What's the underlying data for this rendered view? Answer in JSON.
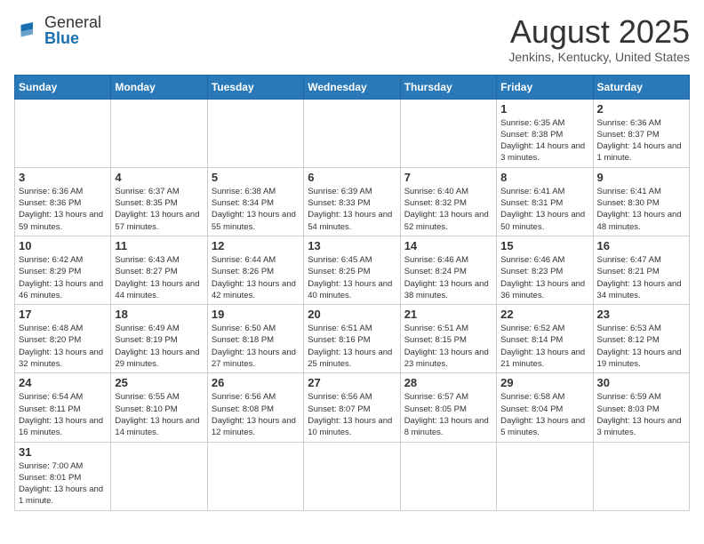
{
  "header": {
    "logo_general": "General",
    "logo_blue": "Blue",
    "month_title": "August 2025",
    "location": "Jenkins, Kentucky, United States"
  },
  "days_of_week": [
    "Sunday",
    "Monday",
    "Tuesday",
    "Wednesday",
    "Thursday",
    "Friday",
    "Saturday"
  ],
  "weeks": [
    [
      {
        "day": "",
        "info": ""
      },
      {
        "day": "",
        "info": ""
      },
      {
        "day": "",
        "info": ""
      },
      {
        "day": "",
        "info": ""
      },
      {
        "day": "",
        "info": ""
      },
      {
        "day": "1",
        "info": "Sunrise: 6:35 AM\nSunset: 8:38 PM\nDaylight: 14 hours and 3 minutes."
      },
      {
        "day": "2",
        "info": "Sunrise: 6:36 AM\nSunset: 8:37 PM\nDaylight: 14 hours and 1 minute."
      }
    ],
    [
      {
        "day": "3",
        "info": "Sunrise: 6:36 AM\nSunset: 8:36 PM\nDaylight: 13 hours and 59 minutes."
      },
      {
        "day": "4",
        "info": "Sunrise: 6:37 AM\nSunset: 8:35 PM\nDaylight: 13 hours and 57 minutes."
      },
      {
        "day": "5",
        "info": "Sunrise: 6:38 AM\nSunset: 8:34 PM\nDaylight: 13 hours and 55 minutes."
      },
      {
        "day": "6",
        "info": "Sunrise: 6:39 AM\nSunset: 8:33 PM\nDaylight: 13 hours and 54 minutes."
      },
      {
        "day": "7",
        "info": "Sunrise: 6:40 AM\nSunset: 8:32 PM\nDaylight: 13 hours and 52 minutes."
      },
      {
        "day": "8",
        "info": "Sunrise: 6:41 AM\nSunset: 8:31 PM\nDaylight: 13 hours and 50 minutes."
      },
      {
        "day": "9",
        "info": "Sunrise: 6:41 AM\nSunset: 8:30 PM\nDaylight: 13 hours and 48 minutes."
      }
    ],
    [
      {
        "day": "10",
        "info": "Sunrise: 6:42 AM\nSunset: 8:29 PM\nDaylight: 13 hours and 46 minutes."
      },
      {
        "day": "11",
        "info": "Sunrise: 6:43 AM\nSunset: 8:27 PM\nDaylight: 13 hours and 44 minutes."
      },
      {
        "day": "12",
        "info": "Sunrise: 6:44 AM\nSunset: 8:26 PM\nDaylight: 13 hours and 42 minutes."
      },
      {
        "day": "13",
        "info": "Sunrise: 6:45 AM\nSunset: 8:25 PM\nDaylight: 13 hours and 40 minutes."
      },
      {
        "day": "14",
        "info": "Sunrise: 6:46 AM\nSunset: 8:24 PM\nDaylight: 13 hours and 38 minutes."
      },
      {
        "day": "15",
        "info": "Sunrise: 6:46 AM\nSunset: 8:23 PM\nDaylight: 13 hours and 36 minutes."
      },
      {
        "day": "16",
        "info": "Sunrise: 6:47 AM\nSunset: 8:21 PM\nDaylight: 13 hours and 34 minutes."
      }
    ],
    [
      {
        "day": "17",
        "info": "Sunrise: 6:48 AM\nSunset: 8:20 PM\nDaylight: 13 hours and 32 minutes."
      },
      {
        "day": "18",
        "info": "Sunrise: 6:49 AM\nSunset: 8:19 PM\nDaylight: 13 hours and 29 minutes."
      },
      {
        "day": "19",
        "info": "Sunrise: 6:50 AM\nSunset: 8:18 PM\nDaylight: 13 hours and 27 minutes."
      },
      {
        "day": "20",
        "info": "Sunrise: 6:51 AM\nSunset: 8:16 PM\nDaylight: 13 hours and 25 minutes."
      },
      {
        "day": "21",
        "info": "Sunrise: 6:51 AM\nSunset: 8:15 PM\nDaylight: 13 hours and 23 minutes."
      },
      {
        "day": "22",
        "info": "Sunrise: 6:52 AM\nSunset: 8:14 PM\nDaylight: 13 hours and 21 minutes."
      },
      {
        "day": "23",
        "info": "Sunrise: 6:53 AM\nSunset: 8:12 PM\nDaylight: 13 hours and 19 minutes."
      }
    ],
    [
      {
        "day": "24",
        "info": "Sunrise: 6:54 AM\nSunset: 8:11 PM\nDaylight: 13 hours and 16 minutes."
      },
      {
        "day": "25",
        "info": "Sunrise: 6:55 AM\nSunset: 8:10 PM\nDaylight: 13 hours and 14 minutes."
      },
      {
        "day": "26",
        "info": "Sunrise: 6:56 AM\nSunset: 8:08 PM\nDaylight: 13 hours and 12 minutes."
      },
      {
        "day": "27",
        "info": "Sunrise: 6:56 AM\nSunset: 8:07 PM\nDaylight: 13 hours and 10 minutes."
      },
      {
        "day": "28",
        "info": "Sunrise: 6:57 AM\nSunset: 8:05 PM\nDaylight: 13 hours and 8 minutes."
      },
      {
        "day": "29",
        "info": "Sunrise: 6:58 AM\nSunset: 8:04 PM\nDaylight: 13 hours and 5 minutes."
      },
      {
        "day": "30",
        "info": "Sunrise: 6:59 AM\nSunset: 8:03 PM\nDaylight: 13 hours and 3 minutes."
      }
    ],
    [
      {
        "day": "31",
        "info": "Sunrise: 7:00 AM\nSunset: 8:01 PM\nDaylight: 13 hours and 1 minute."
      },
      {
        "day": "",
        "info": ""
      },
      {
        "day": "",
        "info": ""
      },
      {
        "day": "",
        "info": ""
      },
      {
        "day": "",
        "info": ""
      },
      {
        "day": "",
        "info": ""
      },
      {
        "day": "",
        "info": ""
      }
    ]
  ]
}
